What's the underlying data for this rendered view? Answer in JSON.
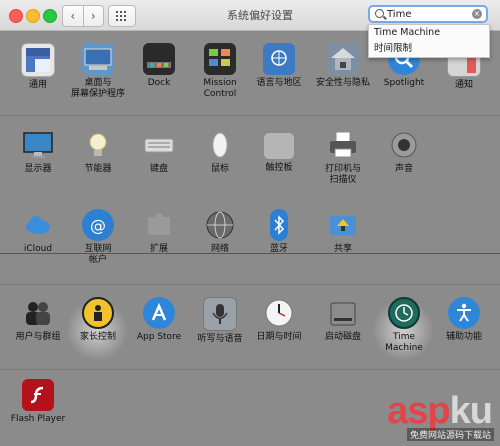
{
  "window": {
    "title": "系统偏好设置"
  },
  "toolbar": {
    "back": "‹",
    "forward": "›"
  },
  "search": {
    "value": "Time",
    "clear_glyph": "×"
  },
  "suggestions": [
    "Time Machine",
    "时间限制"
  ],
  "items": {
    "general": "通用",
    "desktop": "桌面与\n屏幕保护程序",
    "dock": "Dock",
    "mission": "Mission\nControl",
    "language": "语言与地区",
    "security": "安全性与隐私",
    "spotlight": "Spotlight",
    "notify": "通知",
    "display": "显示器",
    "energy": "节能器",
    "keyboard": "键盘",
    "mouse": "鼠标",
    "trackpad": "触控板",
    "printer": "打印机与\n扫描仪",
    "sound": "声音",
    "icloud": "iCloud",
    "internet": "互联网\n帐户",
    "extensions": "扩展",
    "network": "网络",
    "bluetooth": "蓝牙",
    "sharing": "共享",
    "users": "用户与群组",
    "parental": "家长控制",
    "appstore": "App Store",
    "dictation": "听写与语音",
    "datetime": "日期与时间",
    "startup": "启动磁盘",
    "timemachine": "Time Machine",
    "accessibility": "辅助功能",
    "flash": "Flash Player"
  },
  "watermark": {
    "main_a": "asp",
    "main_b": "ku",
    "sub": "免费网站源码下载站"
  }
}
